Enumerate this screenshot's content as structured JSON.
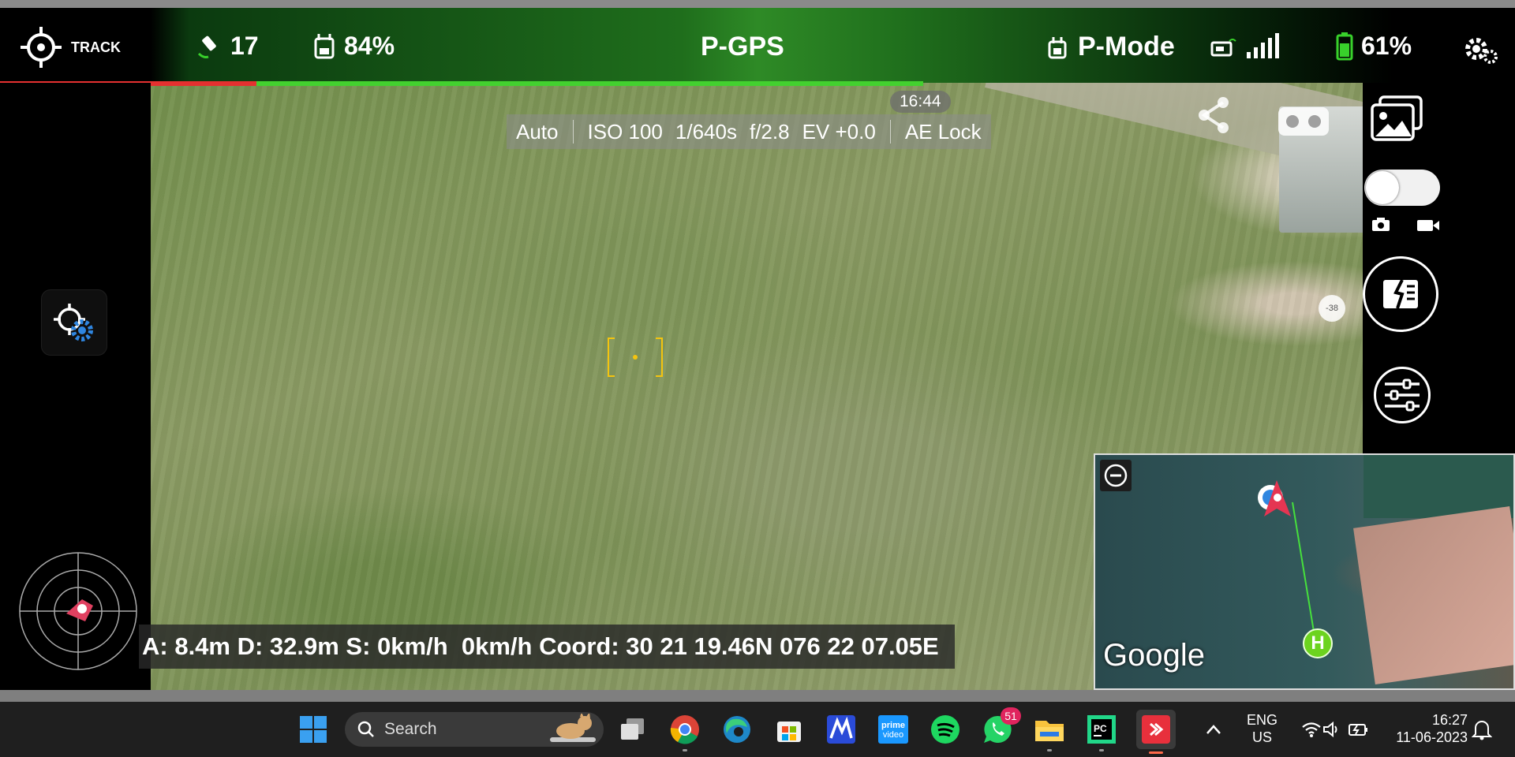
{
  "topbar": {
    "track_label": "TRACK",
    "satellites": "17",
    "rc_battery": "84%",
    "flight_mode": "P-GPS",
    "pilot_mode": "P-Mode",
    "drone_battery": "61%"
  },
  "camera": {
    "clock": "16:44",
    "mode": "Auto",
    "iso": "ISO 100",
    "shutter": "1/640s",
    "aperture": "f/2.8",
    "ev": "EV +0.0",
    "ae_lock": "AE Lock",
    "compass": "-38"
  },
  "telemetry": {
    "text": "A: 8.4m D: 32.9m S: 0km/h  0km/h Coord: 30 21 19.46N 076 22 07.05E"
  },
  "minimap": {
    "provider": "Google",
    "home_label": "H"
  },
  "taskbar": {
    "search_placeholder": "Search",
    "whatsapp_badge": "51",
    "lang_line1": "ENG",
    "lang_line2": "US",
    "time": "16:27",
    "date": "11-06-2023",
    "prime_label_1": "prime",
    "prime_label_2": "video",
    "pc_label": "PC"
  },
  "colors": {
    "progress_green": "#43d12f",
    "progress_red": "#e53030",
    "focus_yellow": "#f4c40f",
    "home_green": "#6cd31f"
  }
}
